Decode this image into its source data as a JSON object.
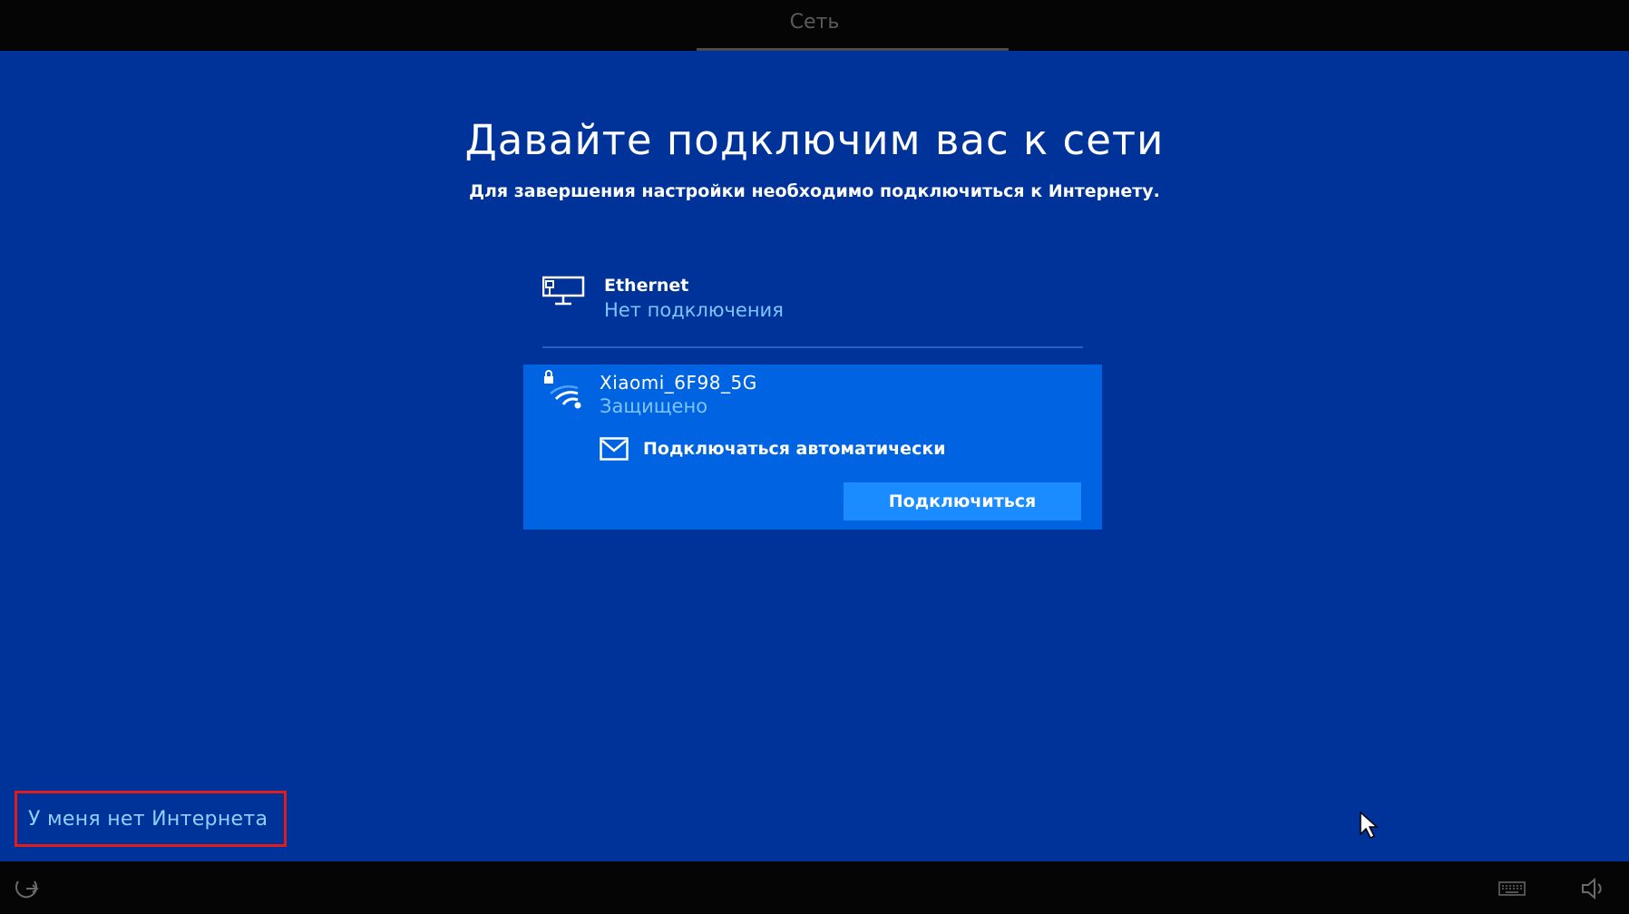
{
  "header": {
    "step_title": "Сеть"
  },
  "main": {
    "heading": "Давайте подключим вас к сети",
    "subheading": "Для завершения настройки необходимо подключиться к Интернету."
  },
  "networks": {
    "ethernet": {
      "icon": "ethernet-icon",
      "name": "Ethernet",
      "status": "Нет подключения"
    },
    "wifi": {
      "icon": "wifi-secured-icon",
      "name": "Xiaomi_6F98_5G",
      "status": "Защищено",
      "auto_connect_label": "Подключаться автоматически",
      "auto_connect_checked": true,
      "connect_label": "Подключиться"
    }
  },
  "footer": {
    "no_internet_label": "У меня нет Интернета",
    "ease_of_access_icon": "ease-of-access-icon",
    "keyboard_icon": "keyboard-icon",
    "volume_icon": "volume-icon"
  },
  "colors": {
    "background": "#003399",
    "selected_network": "#0063e1",
    "button": "#1a8cff",
    "accent_text": "#7fc4ff",
    "highlight_border": "#e21b1b"
  }
}
